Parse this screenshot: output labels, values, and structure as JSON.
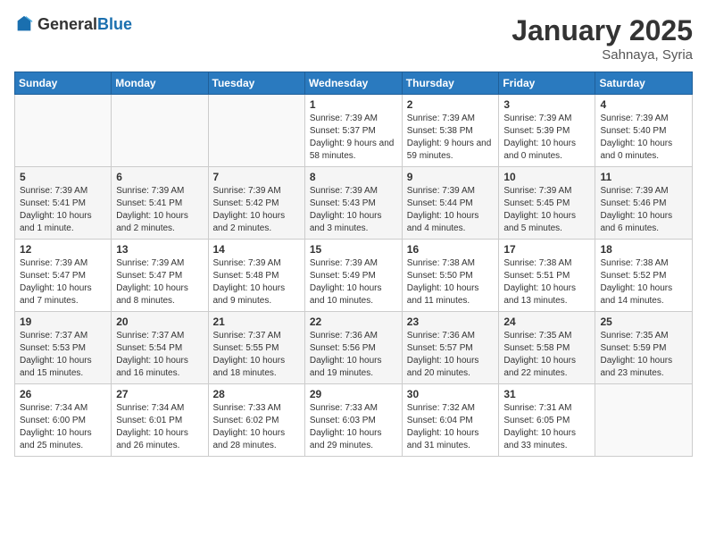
{
  "header": {
    "logo_general": "General",
    "logo_blue": "Blue",
    "month_title": "January 2025",
    "location": "Sahnaya, Syria"
  },
  "days_of_week": [
    "Sunday",
    "Monday",
    "Tuesday",
    "Wednesday",
    "Thursday",
    "Friday",
    "Saturday"
  ],
  "weeks": [
    {
      "row": 1,
      "days": [
        {
          "num": "",
          "info": ""
        },
        {
          "num": "",
          "info": ""
        },
        {
          "num": "",
          "info": ""
        },
        {
          "num": "1",
          "info": "Sunrise: 7:39 AM\nSunset: 5:37 PM\nDaylight: 9 hours and 58 minutes."
        },
        {
          "num": "2",
          "info": "Sunrise: 7:39 AM\nSunset: 5:38 PM\nDaylight: 9 hours and 59 minutes."
        },
        {
          "num": "3",
          "info": "Sunrise: 7:39 AM\nSunset: 5:39 PM\nDaylight: 10 hours and 0 minutes."
        },
        {
          "num": "4",
          "info": "Sunrise: 7:39 AM\nSunset: 5:40 PM\nDaylight: 10 hours and 0 minutes."
        }
      ]
    },
    {
      "row": 2,
      "days": [
        {
          "num": "5",
          "info": "Sunrise: 7:39 AM\nSunset: 5:41 PM\nDaylight: 10 hours and 1 minute."
        },
        {
          "num": "6",
          "info": "Sunrise: 7:39 AM\nSunset: 5:41 PM\nDaylight: 10 hours and 2 minutes."
        },
        {
          "num": "7",
          "info": "Sunrise: 7:39 AM\nSunset: 5:42 PM\nDaylight: 10 hours and 2 minutes."
        },
        {
          "num": "8",
          "info": "Sunrise: 7:39 AM\nSunset: 5:43 PM\nDaylight: 10 hours and 3 minutes."
        },
        {
          "num": "9",
          "info": "Sunrise: 7:39 AM\nSunset: 5:44 PM\nDaylight: 10 hours and 4 minutes."
        },
        {
          "num": "10",
          "info": "Sunrise: 7:39 AM\nSunset: 5:45 PM\nDaylight: 10 hours and 5 minutes."
        },
        {
          "num": "11",
          "info": "Sunrise: 7:39 AM\nSunset: 5:46 PM\nDaylight: 10 hours and 6 minutes."
        }
      ]
    },
    {
      "row": 3,
      "days": [
        {
          "num": "12",
          "info": "Sunrise: 7:39 AM\nSunset: 5:47 PM\nDaylight: 10 hours and 7 minutes."
        },
        {
          "num": "13",
          "info": "Sunrise: 7:39 AM\nSunset: 5:47 PM\nDaylight: 10 hours and 8 minutes."
        },
        {
          "num": "14",
          "info": "Sunrise: 7:39 AM\nSunset: 5:48 PM\nDaylight: 10 hours and 9 minutes."
        },
        {
          "num": "15",
          "info": "Sunrise: 7:39 AM\nSunset: 5:49 PM\nDaylight: 10 hours and 10 minutes."
        },
        {
          "num": "16",
          "info": "Sunrise: 7:38 AM\nSunset: 5:50 PM\nDaylight: 10 hours and 11 minutes."
        },
        {
          "num": "17",
          "info": "Sunrise: 7:38 AM\nSunset: 5:51 PM\nDaylight: 10 hours and 13 minutes."
        },
        {
          "num": "18",
          "info": "Sunrise: 7:38 AM\nSunset: 5:52 PM\nDaylight: 10 hours and 14 minutes."
        }
      ]
    },
    {
      "row": 4,
      "days": [
        {
          "num": "19",
          "info": "Sunrise: 7:37 AM\nSunset: 5:53 PM\nDaylight: 10 hours and 15 minutes."
        },
        {
          "num": "20",
          "info": "Sunrise: 7:37 AM\nSunset: 5:54 PM\nDaylight: 10 hours and 16 minutes."
        },
        {
          "num": "21",
          "info": "Sunrise: 7:37 AM\nSunset: 5:55 PM\nDaylight: 10 hours and 18 minutes."
        },
        {
          "num": "22",
          "info": "Sunrise: 7:36 AM\nSunset: 5:56 PM\nDaylight: 10 hours and 19 minutes."
        },
        {
          "num": "23",
          "info": "Sunrise: 7:36 AM\nSunset: 5:57 PM\nDaylight: 10 hours and 20 minutes."
        },
        {
          "num": "24",
          "info": "Sunrise: 7:35 AM\nSunset: 5:58 PM\nDaylight: 10 hours and 22 minutes."
        },
        {
          "num": "25",
          "info": "Sunrise: 7:35 AM\nSunset: 5:59 PM\nDaylight: 10 hours and 23 minutes."
        }
      ]
    },
    {
      "row": 5,
      "days": [
        {
          "num": "26",
          "info": "Sunrise: 7:34 AM\nSunset: 6:00 PM\nDaylight: 10 hours and 25 minutes."
        },
        {
          "num": "27",
          "info": "Sunrise: 7:34 AM\nSunset: 6:01 PM\nDaylight: 10 hours and 26 minutes."
        },
        {
          "num": "28",
          "info": "Sunrise: 7:33 AM\nSunset: 6:02 PM\nDaylight: 10 hours and 28 minutes."
        },
        {
          "num": "29",
          "info": "Sunrise: 7:33 AM\nSunset: 6:03 PM\nDaylight: 10 hours and 29 minutes."
        },
        {
          "num": "30",
          "info": "Sunrise: 7:32 AM\nSunset: 6:04 PM\nDaylight: 10 hours and 31 minutes."
        },
        {
          "num": "31",
          "info": "Sunrise: 7:31 AM\nSunset: 6:05 PM\nDaylight: 10 hours and 33 minutes."
        },
        {
          "num": "",
          "info": ""
        }
      ]
    }
  ]
}
